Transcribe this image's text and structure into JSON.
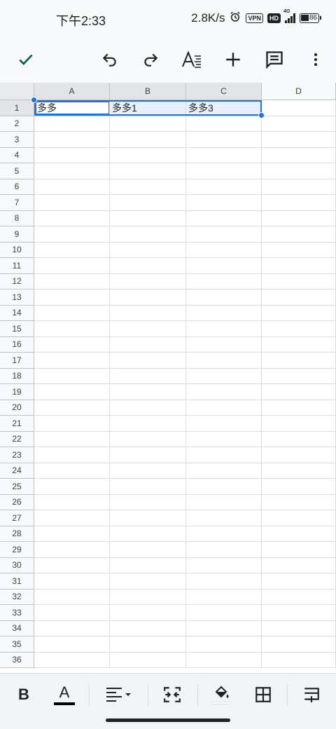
{
  "status_bar": {
    "time": "下午2:33",
    "network_speed": "2.8K/s",
    "vpn_label": "VPN",
    "hd_label": "HD",
    "network_type": "4G",
    "battery_level": "86"
  },
  "toolbar": {
    "confirm_icon": "check-icon",
    "undo_icon": "undo-icon",
    "redo_icon": "redo-icon",
    "text_format_icon": "text-format-icon",
    "insert_icon": "plus-icon",
    "comment_icon": "comment-icon",
    "more_icon": "more-vert-icon"
  },
  "sheet": {
    "columns": [
      "A",
      "B",
      "C",
      "D"
    ],
    "rows": [
      "1",
      "2",
      "3",
      "4",
      "5",
      "6",
      "7",
      "8",
      "9",
      "10",
      "11",
      "12",
      "13",
      "14",
      "15",
      "16",
      "17",
      "18",
      "19",
      "20",
      "21",
      "22",
      "23",
      "24",
      "25",
      "26",
      "27",
      "28",
      "29",
      "30",
      "31",
      "32",
      "33",
      "34",
      "35",
      "36"
    ],
    "cells": {
      "A1": "多多",
      "B1": "多多1",
      "C1": "多多3"
    },
    "selection": "A1:C1",
    "accent_color": "#1a73e8"
  },
  "format_bar": {
    "bold_label": "B",
    "text_color_label": "A",
    "align_icon": "align-left-icon",
    "merge_icon": "merge-cells-icon",
    "fill_color_icon": "fill-color-icon",
    "borders_icon": "borders-icon",
    "insert_row_icon": "insert-row-icon"
  }
}
